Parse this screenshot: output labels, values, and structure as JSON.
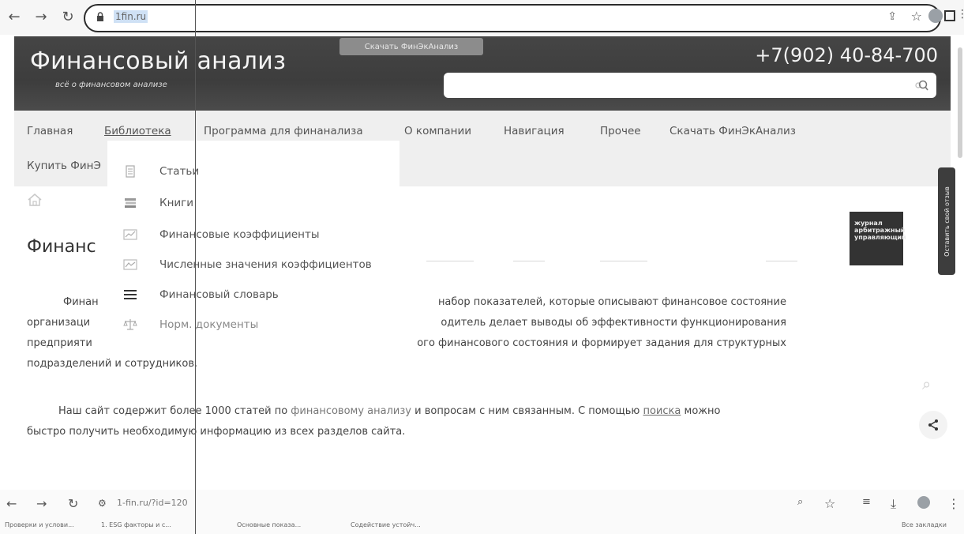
{
  "browser": {
    "url": "1fin.ru",
    "bottom_url": "1-fin.ru/?id=120",
    "bookmarks": [
      "Проверки и услови...",
      "1. ESG факторы и с...",
      "Основные показа...",
      "Содействие устойч..."
    ],
    "all_bookmarks": "Все закладки"
  },
  "header": {
    "title": "Финансовый анализ",
    "subtitle": "всё о финансовом анализе",
    "download_chip": "Скачать ФинЭкАнализ",
    "phone": "+7(902) 40-84-700",
    "search_placeholder": ""
  },
  "nav": {
    "items": [
      "Главная",
      "Библиотека",
      "Программа для финанализа",
      "О компании",
      "Навигация",
      "Прочее",
      "Скачать ФинЭкАнализ"
    ],
    "active": "Библиотека",
    "second_row": "Купить ФинЭ"
  },
  "dropdown": {
    "items": [
      {
        "label": "Статьи",
        "icon": "article-icon"
      },
      {
        "label": "Книги",
        "icon": "books-icon"
      },
      {
        "label": "Финансовые коэффициенты",
        "icon": "chart-icon"
      },
      {
        "label": "Численные значения коэффициентов",
        "icon": "chart-icon"
      },
      {
        "label": "Финансовый словарь",
        "icon": "list-icon"
      },
      {
        "label": "Норм. документы",
        "icon": "scales-icon"
      }
    ]
  },
  "content": {
    "heading_visible": "Финанс",
    "p1": {
      "lines": [
        {
          "left": "Финан",
          "right": "набор показателей, которые описывают финансовое состояние"
        },
        {
          "left": "организаци",
          "right": "одитель делает выводы об эффективности функционирования"
        },
        {
          "left": "предприяти",
          "right": "ого финансового состояния и формирует задания для структурных"
        },
        {
          "left": "подразделений и сотрудников.",
          "right": ""
        }
      ]
    },
    "p2": {
      "part1": "Наш сайт содержит более 1000 статей по ",
      "link1": "финансовому анализу",
      "part2": " и вопросам с ним связанным. С помощью ",
      "link2": "поиска",
      "part3": " можно",
      "line2": "быстро получить необходимую информацию из всех разделов сайта."
    }
  },
  "side": {
    "journal": "журнал арбитражный управляющий",
    "feedback": "Оставить свой отзыв"
  }
}
